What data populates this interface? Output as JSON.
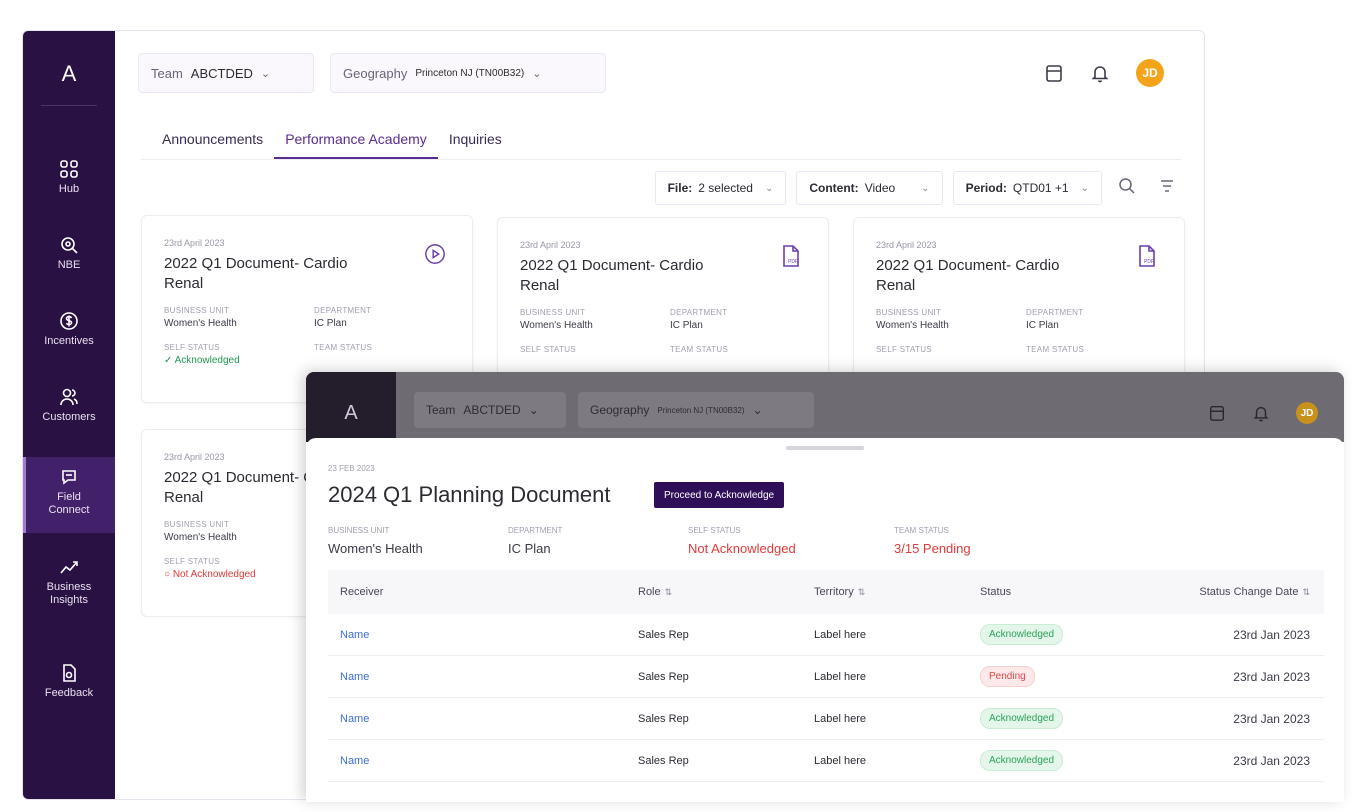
{
  "sidebar": {
    "logo": "A",
    "items": [
      {
        "label": "Hub"
      },
      {
        "label": "NBE"
      },
      {
        "label": "Incentives"
      },
      {
        "label": "Customers"
      },
      {
        "label": "Field Connect"
      },
      {
        "label": "Business Insights"
      },
      {
        "label": "Feedback"
      }
    ]
  },
  "topbar": {
    "team_label": "Team",
    "team_value": "ABCTDED",
    "geo_label": "Geography",
    "geo_value": "Princeton NJ (TN00B32)",
    "avatar": "JD"
  },
  "tabs": [
    "Announcements",
    "Performance Academy",
    "Inquiries"
  ],
  "filters": {
    "file_label": "File:",
    "file_value": "2 selected",
    "content_label": "Content:",
    "content_value": "Video",
    "period_label": "Period:",
    "period_value": "QTD01 +1"
  },
  "cards": [
    {
      "date": "23rd April 2023",
      "title": "2022 Q1 Document- Cardio Renal",
      "bu_key": "BUSINESS UNIT",
      "bu": "Women's Health",
      "dept_key": "DEPARTMENT",
      "dept": "IC Plan",
      "self_key": "SELF STATUS",
      "self": "Acknowledged",
      "team_key": "TEAM STATUS",
      "icon": "play-icon"
    },
    {
      "date": "23rd April 2023",
      "title": "2022 Q1 Document- Cardio Renal",
      "bu_key": "BUSINESS UNIT",
      "bu": "Women's Health",
      "dept_key": "DEPARTMENT",
      "dept": "IC Plan",
      "self_key": "SELF STATUS",
      "team_key": "TEAM STATUS",
      "icon": "pdf-file-icon"
    },
    {
      "date": "23rd April 2023",
      "title": "2022 Q1 Document- Cardio Renal",
      "bu_key": "BUSINESS UNIT",
      "bu": "Women's Health",
      "dept_key": "DEPARTMENT",
      "dept": "IC Plan",
      "self_key": "SELF STATUS",
      "team_key": "TEAM STATUS",
      "icon": "pdf-file-icon"
    },
    {
      "date": "23rd April 2023",
      "title": "2022 Q1 Document- Cardio Renal",
      "bu_key": "BUSINESS UNIT",
      "bu": "Women's Health",
      "self_key": "SELF STATUS",
      "self": "Not Acknowledged"
    }
  ],
  "front": {
    "logo": "A",
    "team_label": "Team",
    "team_value": "ABCTDED",
    "geo_label": "Geography",
    "geo_value": "Princeton NJ (TN00B32)",
    "avatar": "JD",
    "doc_date": "23 FEB 2023",
    "doc_title": "2024 Q1 Planning Document",
    "action_button": "Proceed to Acknowledge",
    "meta": [
      {
        "key": "BUSINESS UNIT",
        "value": "Women's Health"
      },
      {
        "key": "DEPARTMENT",
        "value": "IC Plan"
      },
      {
        "key": "SELF STATUS",
        "value": "Not Acknowledged"
      },
      {
        "key": "TEAM STATUS",
        "value": "3/15 Pending"
      }
    ],
    "table": {
      "headers": [
        "Receiver",
        "Role",
        "Territory",
        "Status",
        "Status Change Date"
      ],
      "rows": [
        {
          "receiver": "Name",
          "role": "Sales Rep",
          "territory": "Label here",
          "status": "Acknowledged",
          "date": "23rd Jan 2023"
        },
        {
          "receiver": "Name",
          "role": "Sales Rep",
          "territory": "Label here",
          "status": "Pending",
          "date": "23rd Jan 2023"
        },
        {
          "receiver": "Name",
          "role": "Sales Rep",
          "territory": "Label here",
          "status": "Acknowledged",
          "date": "23rd Jan 2023"
        },
        {
          "receiver": "Name",
          "role": "Sales Rep",
          "territory": "Label here",
          "status": "Acknowledged",
          "date": "23rd Jan 2023"
        }
      ]
    }
  },
  "colors": {
    "sidebar_bg": "#2a1144",
    "accent": "#5a2d91",
    "avatar": "#f4a41b",
    "acknowledged": "#2ca35a",
    "pending": "#e04848"
  }
}
